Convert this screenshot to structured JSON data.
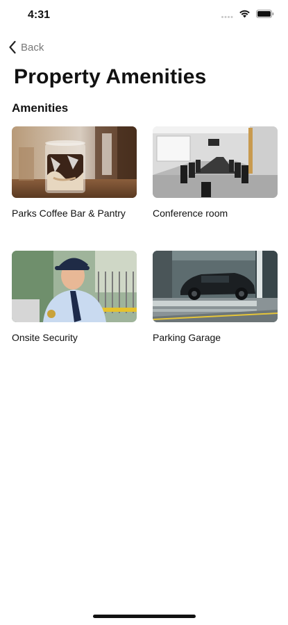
{
  "status_bar": {
    "time": "4:31",
    "icons": [
      "signal-icon",
      "wifi-icon",
      "battery-icon"
    ]
  },
  "nav": {
    "back_label": "Back",
    "back_icon": "chevron-left-icon"
  },
  "page": {
    "title": "Property Amenities"
  },
  "section": {
    "title": "Amenities"
  },
  "amenities": [
    {
      "label": "Parks Coffee Bar & Pantry",
      "image": "iced-coffee-photo"
    },
    {
      "label": "Conference room",
      "image": "conference-room-photo"
    },
    {
      "label": "Onsite Security",
      "image": "security-guard-photo"
    },
    {
      "label": "Parking Garage",
      "image": "parking-garage-photo"
    }
  ]
}
